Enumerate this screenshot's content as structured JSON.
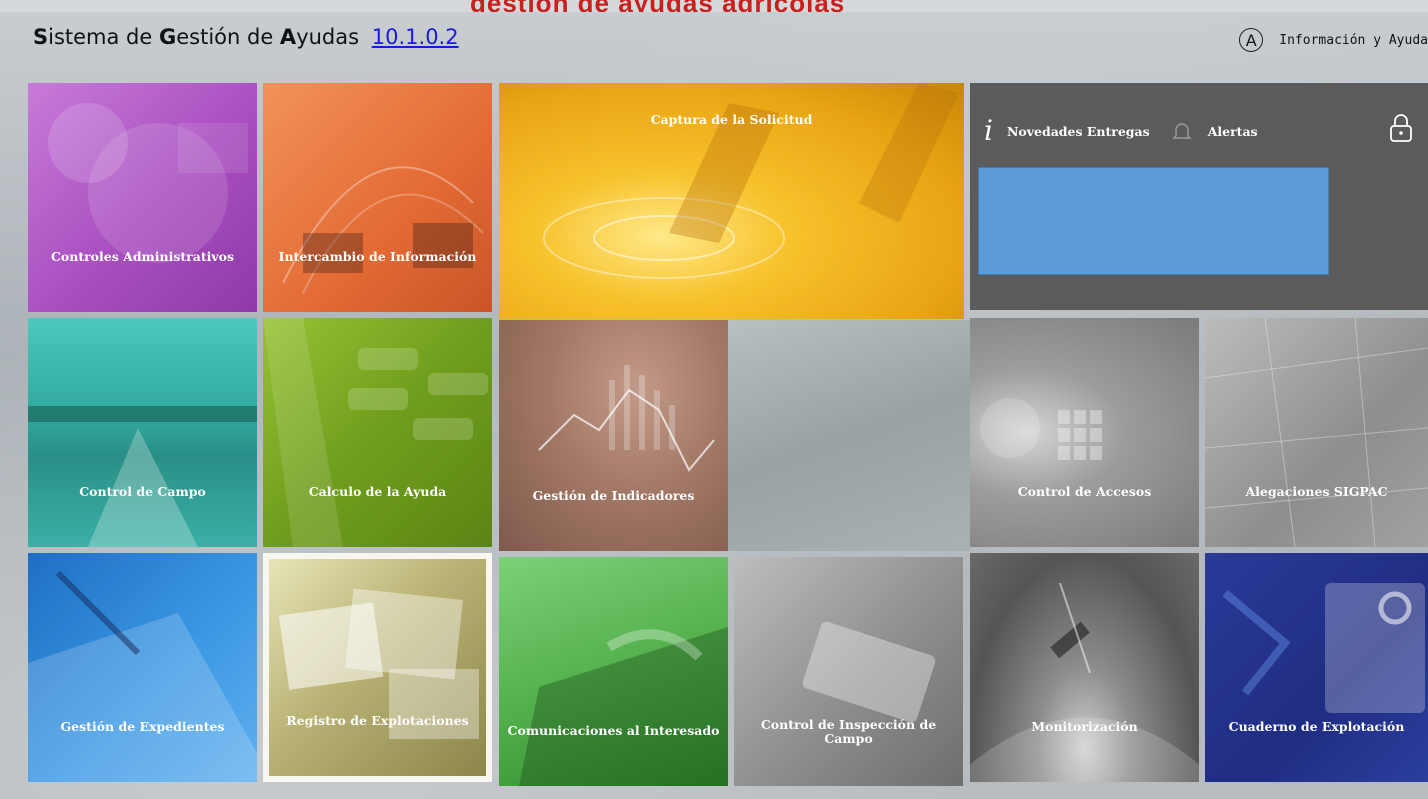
{
  "header": {
    "banner_fragment": "gestion de ayudas agricolas",
    "title_parts": [
      "S",
      "istema de ",
      "G",
      "estión de ",
      "A",
      "yudas"
    ],
    "version": "10.1.0.2",
    "help_icon_letter": "A",
    "help_label": "Información y Ayuda"
  },
  "panel": {
    "news_label": "Novedades Entregas",
    "alerts_label": "Alertas"
  },
  "tiles": {
    "controles_administrativos": "Controles Administrativos",
    "intercambio_informacion": "Intercambio de Información",
    "captura_solicitud": "Captura de la Solicitud",
    "control_campo": "Control de Campo",
    "calculo_ayuda": "Calculo de la Ayuda",
    "gestion_indicadores": "Gestión de Indicadores",
    "control_accesos": "Control de Accesos",
    "alegaciones_sigpac": "Alegaciones SIGPAC",
    "gestion_expedientes": "Gestión de Expedientes",
    "registro_explotaciones": "Registro de Explotaciones",
    "comunicaciones_interesado": "Comunicaciones al Interesado",
    "control_inspeccion_campo": "Control de Inspección de Campo",
    "monitorizacion": "Monitorización",
    "cuaderno_explotacion": "Cuaderno de Explotación"
  },
  "colors": {
    "purple": "#b25ec8",
    "orange": "#e9743f",
    "yellow": "#f2a91a",
    "teal": "#31b6ad",
    "green_lime": "#7cab22",
    "brown": "#a07462",
    "blue": "#2d8bd6",
    "olive_light": "#b7b06c",
    "green": "#54b04d",
    "gray": "#8a8a8a",
    "navy": "#21318c",
    "panel": "#5b5b5b",
    "panel_box": "#5a9bd8"
  }
}
